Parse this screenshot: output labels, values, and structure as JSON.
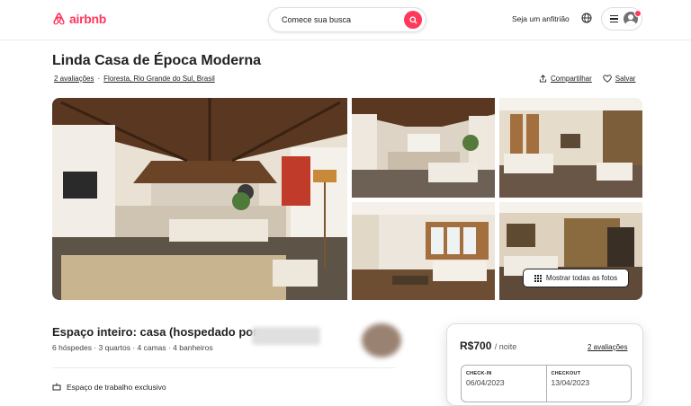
{
  "header": {
    "logo_text": "airbnb",
    "search_label": "Comece sua busca",
    "host_link": "Seja um anfitrião",
    "brand_color": "#ff385c"
  },
  "listing": {
    "title": "Linda Casa de Época Moderna",
    "reviews_link": "2 avaliações",
    "separator": "·",
    "location": "Floresta, Rio Grande do Sul, Brasil",
    "share_label": "Compartilhar",
    "save_label": "Salvar",
    "show_all_photos": "Mostrar todas as fotos"
  },
  "summary": {
    "heading": "Espaço inteiro: casa (hospedado por",
    "details": "6 hóspedes · 3 quartos · 4 camas · 4 banheiros",
    "feature_partial": "Espaço de trabalho exclusivo"
  },
  "booking": {
    "price": "R$700",
    "per_night": "/ noite",
    "reviews": "2 avaliações",
    "checkin_label": "CHECK-IN",
    "checkin_value": "06/04/2023",
    "checkout_label": "CHECKOUT",
    "checkout_value": "13/04/2023"
  },
  "icons": [
    "airbnb-logo-icon",
    "search-icon",
    "globe-icon",
    "menu-icon",
    "avatar",
    "share-icon",
    "heart-icon",
    "grid-icon",
    "workspace-icon"
  ]
}
